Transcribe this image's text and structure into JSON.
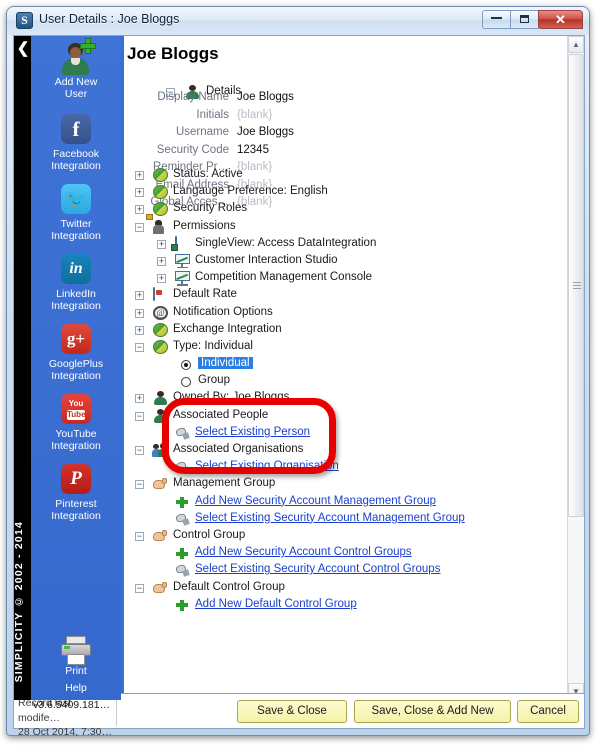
{
  "window": {
    "title": "User Details : Joe Bloggs",
    "app_icon": "simplicity-s-icon",
    "minimize": "minimize-icon",
    "maximize": "maximize-icon",
    "close": "✕"
  },
  "sidebar": {
    "back_arrow": "❮",
    "copyright": "SIMPLICITY © 2002 - 2014",
    "items": [
      {
        "icon": "add-new-user-icon",
        "line1": "Add New",
        "line2": "User"
      },
      {
        "icon": "facebook-icon",
        "line1": "Facebook",
        "line2": "Integration",
        "glyph": "f"
      },
      {
        "icon": "twitter-icon",
        "line1": "Twitter",
        "line2": "Integration",
        "glyph": "🐦"
      },
      {
        "icon": "linkedin-icon",
        "line1": "LinkedIn",
        "line2": "Integration",
        "glyph": "in"
      },
      {
        "icon": "googleplus-icon",
        "line1": "GooglePlus",
        "line2": "Integration",
        "glyph": "g+"
      },
      {
        "icon": "youtube-icon",
        "line1": "YouTube",
        "line2": "Integration",
        "glyph_top": "You",
        "glyph_bottom": "Tube"
      },
      {
        "icon": "pinterest-icon",
        "line1": "Pinterest",
        "line2": "Integration",
        "glyph": "P"
      }
    ],
    "print": {
      "label": "Print",
      "icon": "printer-icon"
    },
    "help": "Help",
    "version": "v3.6.5409.181…"
  },
  "page": {
    "title": "Joe Bloggs",
    "details_node": {
      "label": "Details",
      "expander": "−",
      "icon": "person-icon"
    },
    "fields": [
      {
        "name": "Display Name",
        "value": "Joe Bloggs",
        "blank": false
      },
      {
        "name": "Initials",
        "value": "{blank}",
        "blank": true
      },
      {
        "name": "Username",
        "value": "Joe Bloggs",
        "blank": false
      },
      {
        "name": "Security Code",
        "value": "12345",
        "blank": false
      },
      {
        "name": "Reminder Pr…",
        "value": "{blank}",
        "blank": true
      },
      {
        "name": "Email Address",
        "value": "{blank}",
        "blank": true
      },
      {
        "name": "Global Acces…",
        "value": "{blank}",
        "blank": true
      }
    ],
    "tree": [
      {
        "label": "Status:  Active",
        "expander": "+",
        "icon": "globe-icon",
        "indent": 0,
        "type": "node"
      },
      {
        "label": "Langauge Preference:  English",
        "expander": "+",
        "icon": "globe-icon",
        "indent": 0,
        "type": "node"
      },
      {
        "label": "Security Roles",
        "expander": "+",
        "icon": "globe-icon",
        "indent": 0,
        "type": "node"
      },
      {
        "label": "Permissions",
        "expander": "−",
        "icon": "permissions-icon",
        "indent": 0,
        "type": "node"
      },
      {
        "label": "SingleView:  Access DataIntegration",
        "expander": "+",
        "icon": "singleview-icon",
        "indent": 1,
        "type": "node"
      },
      {
        "label": "Customer Interaction Studio",
        "expander": "+",
        "icon": "chart-icon",
        "indent": 1,
        "type": "node"
      },
      {
        "label": "Competition Management Console",
        "expander": "+",
        "icon": "chart-icon",
        "indent": 1,
        "type": "node"
      },
      {
        "label": "Default Rate",
        "expander": "+",
        "icon": "rate-icon",
        "indent": 0,
        "type": "node"
      },
      {
        "label": "Notification Options",
        "expander": "+",
        "icon": "at-icon",
        "indent": 0,
        "type": "node"
      },
      {
        "label": "Exchange Integration",
        "expander": "+",
        "icon": "globe-icon",
        "indent": 0,
        "type": "node"
      },
      {
        "label": "Type:  Individual",
        "expander": "−",
        "icon": "globe-icon",
        "indent": 0,
        "type": "node"
      },
      {
        "label": "Individual",
        "indent": 1,
        "type": "radio",
        "checked": true,
        "selected": true
      },
      {
        "label": "Group",
        "indent": 1,
        "type": "radio",
        "checked": false,
        "selected": false
      },
      {
        "label": "Owned By:  Joe Bloggs",
        "expander": "+",
        "icon": "person-icon",
        "indent": 0,
        "type": "node"
      },
      {
        "label": "Associated People",
        "expander": "−",
        "icon": "person-icon",
        "indent": 0,
        "type": "node"
      },
      {
        "label": "Select Existing Person",
        "icon": "select-icon",
        "indent": 1,
        "type": "link"
      },
      {
        "label": "Associated Organisations",
        "expander": "−",
        "icon": "people-icon",
        "indent": 0,
        "type": "node"
      },
      {
        "label": "Select Existing Organisation",
        "icon": "select-icon",
        "indent": 1,
        "type": "link"
      },
      {
        "label": "Management Group",
        "expander": "−",
        "icon": "hand-icon",
        "indent": 0,
        "type": "node"
      },
      {
        "label": "Add New Security Account Management Group",
        "icon": "plus-icon",
        "indent": 1,
        "type": "link"
      },
      {
        "label": "Select Existing Security Account Management Group",
        "icon": "select-icon",
        "indent": 1,
        "type": "link"
      },
      {
        "label": "Control Group",
        "expander": "−",
        "icon": "hand-icon",
        "indent": 0,
        "type": "node"
      },
      {
        "label": "Add New Security Account Control Groups",
        "icon": "plus-icon",
        "indent": 1,
        "type": "link"
      },
      {
        "label": "Select Existing Security Account Control Groups",
        "icon": "select-icon",
        "indent": 1,
        "type": "link"
      },
      {
        "label": "Default Control Group",
        "expander": "−",
        "icon": "hand-icon",
        "indent": 0,
        "type": "node"
      },
      {
        "label": "Add New Default Control Group",
        "icon": "plus-icon",
        "indent": 1,
        "type": "link"
      }
    ]
  },
  "scrollbar": {
    "up": "▲",
    "down": "▼"
  },
  "bottom": {
    "modified_label": "Record last modife…",
    "modified_value": "28 Oct 2014, 7:30…",
    "save_close": "Save & Close",
    "save_close_add": "Save, Close & Add New",
    "cancel": "Cancel"
  },
  "annotation": {
    "color": "#e60000",
    "shape": "rounded-rectangle",
    "target": "Type: Individual radio group"
  }
}
